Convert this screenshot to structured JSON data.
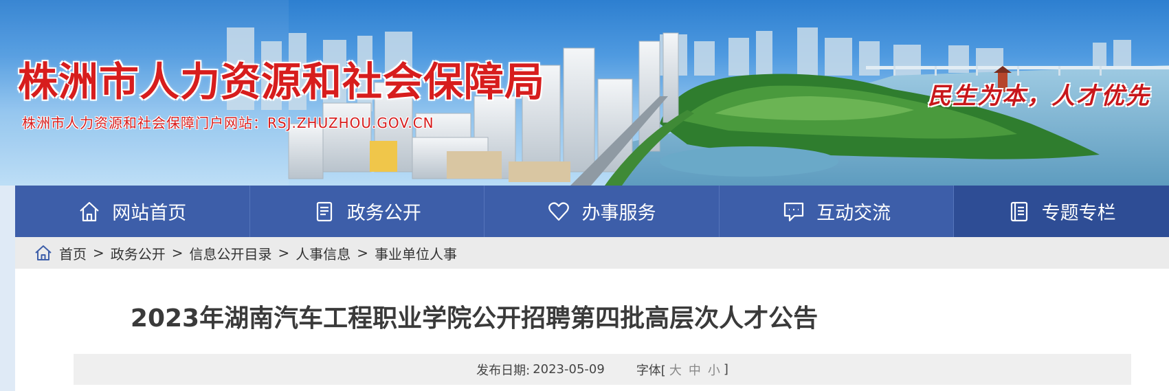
{
  "banner": {
    "site_title": "株洲市人力资源和社会保障局",
    "site_subtitle": "株洲市人力资源和社会保障门户网站：RSJ.ZHUZHOU.GOV.CN",
    "slogan": "民生为本，人才优先"
  },
  "nav": {
    "items": [
      {
        "label": "网站首页",
        "icon": "home-icon"
      },
      {
        "label": "政务公开",
        "icon": "document-icon"
      },
      {
        "label": "办事服务",
        "icon": "heart-icon"
      },
      {
        "label": "互动交流",
        "icon": "chat-icon"
      },
      {
        "label": "专题专栏",
        "icon": "book-icon"
      }
    ]
  },
  "breadcrumb": {
    "icon": "home-icon",
    "separator": ">",
    "items": [
      "首页",
      "政务公开",
      "信息公开目录",
      "人事信息",
      "事业单位人事"
    ]
  },
  "article": {
    "title": "2023年湖南汽车工程职业学院公开招聘第四批高层次人才公告",
    "date_label": "发布日期:",
    "date": "2023-05-09",
    "font_label": "字体[",
    "font_large": "大",
    "font_medium": "中",
    "font_small": "小",
    "font_close": "]"
  },
  "colors": {
    "nav_bg": "#3d5ea9",
    "nav_active_bg": "#2e4d95",
    "title_red": "#d71d1d",
    "breadcrumb_bg": "#ebebeb"
  }
}
